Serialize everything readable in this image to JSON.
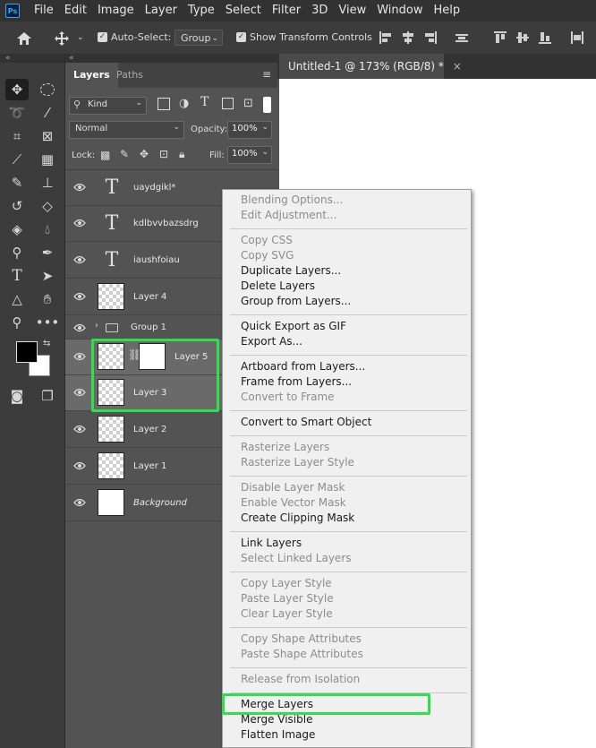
{
  "app": {
    "logo": "Ps"
  },
  "menubar": [
    "File",
    "Edit",
    "Image",
    "Layer",
    "Type",
    "Select",
    "Filter",
    "3D",
    "View",
    "Window",
    "Help"
  ],
  "options_bar": {
    "auto_select_label": "Auto-Select:",
    "auto_select_value": "Group",
    "show_transform_label": "Show Transform Controls"
  },
  "panel": {
    "tabs": [
      "Layers",
      "Paths"
    ],
    "kind_label": "Kind",
    "blend_mode": "Normal",
    "opacity_label": "Opacity:",
    "opacity_value": "100%",
    "lock_label": "Lock:",
    "fill_label": "Fill:",
    "fill_value": "100%"
  },
  "layers": [
    {
      "name": "uaydgikl*",
      "type": "text"
    },
    {
      "name": "kdlbvvbazsdrg",
      "type": "text"
    },
    {
      "name": "iaushfoiau",
      "type": "text"
    },
    {
      "name": "Layer 4",
      "type": "raster"
    },
    {
      "name": "Group 1",
      "type": "group"
    },
    {
      "name": "Layer 5",
      "type": "raster-mask",
      "selected": true
    },
    {
      "name": "Layer 3",
      "type": "raster",
      "selected": true
    },
    {
      "name": "Layer 2",
      "type": "raster"
    },
    {
      "name": "Layer 1",
      "type": "raster"
    },
    {
      "name": "Background",
      "type": "background"
    }
  ],
  "document": {
    "tab_title": "Untitled-1 @ 173% (RGB/8) *",
    "close": "×"
  },
  "context_menu": {
    "groups": [
      [
        {
          "label": "Blending Options...",
          "enabled": false
        },
        {
          "label": "Edit Adjustment...",
          "enabled": false
        }
      ],
      [
        {
          "label": "Copy CSS",
          "enabled": false
        },
        {
          "label": "Copy SVG",
          "enabled": false
        },
        {
          "label": "Duplicate Layers...",
          "enabled": true
        },
        {
          "label": "Delete Layers",
          "enabled": true
        },
        {
          "label": "Group from Layers...",
          "enabled": true
        }
      ],
      [
        {
          "label": "Quick Export as GIF",
          "enabled": true
        },
        {
          "label": "Export As...",
          "enabled": true
        }
      ],
      [
        {
          "label": "Artboard from Layers...",
          "enabled": true
        },
        {
          "label": "Frame from Layers...",
          "enabled": true
        },
        {
          "label": "Convert to Frame",
          "enabled": false
        }
      ],
      [
        {
          "label": "Convert to Smart Object",
          "enabled": true
        }
      ],
      [
        {
          "label": "Rasterize Layers",
          "enabled": false
        },
        {
          "label": "Rasterize Layer Style",
          "enabled": false
        }
      ],
      [
        {
          "label": "Disable Layer Mask",
          "enabled": false
        },
        {
          "label": "Enable Vector Mask",
          "enabled": false
        },
        {
          "label": "Create Clipping Mask",
          "enabled": true
        }
      ],
      [
        {
          "label": "Link Layers",
          "enabled": true
        },
        {
          "label": "Select Linked Layers",
          "enabled": false
        }
      ],
      [
        {
          "label": "Copy Layer Style",
          "enabled": false
        },
        {
          "label": "Paste Layer Style",
          "enabled": false
        },
        {
          "label": "Clear Layer Style",
          "enabled": false
        }
      ],
      [
        {
          "label": "Copy Shape Attributes",
          "enabled": false
        },
        {
          "label": "Paste Shape Attributes",
          "enabled": false
        }
      ],
      [
        {
          "label": "Release from Isolation",
          "enabled": false
        }
      ],
      [
        {
          "label": "Merge Layers",
          "enabled": true
        },
        {
          "label": "Merge Visible",
          "enabled": true
        },
        {
          "label": "Flatten Image",
          "enabled": true
        }
      ]
    ]
  },
  "colors": {
    "highlight": "#2ee04c",
    "menu_bg": "#f0f0f0",
    "panel_bg": "#535353",
    "selected_layer": "#6a6a6a"
  }
}
